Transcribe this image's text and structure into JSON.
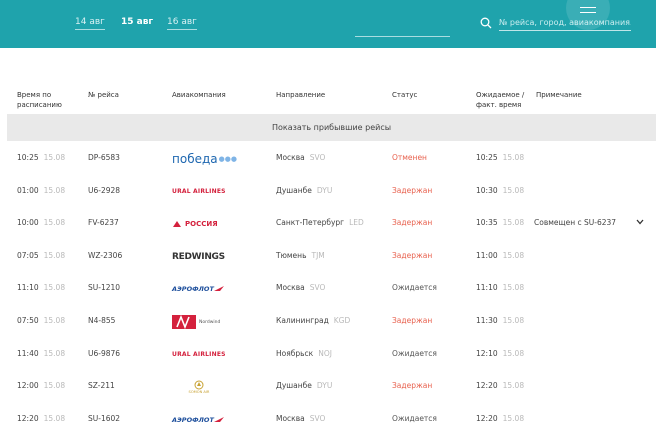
{
  "header": {
    "dates": [
      "14 авг",
      "15 авг",
      "16 авг"
    ],
    "active_date_index": 1,
    "search_placeholder": "№ рейса, город, авиакомпания..."
  },
  "table": {
    "columns": [
      "Время по\nрасписанию",
      "№ рейса",
      "Авиакомпания",
      "Направление",
      "Статус",
      "Ожидаемое /\nфакт. время",
      "Примечание"
    ],
    "show_arrived_label": "Показать прибывшие рейсы",
    "rows": [
      {
        "time": "10:25",
        "date": "15.08",
        "flight": "DP-6583",
        "airline": "pobeda",
        "city": "Москва",
        "code": "SVO",
        "status": "Отменен",
        "status_kind": "red",
        "exp_time": "10:25",
        "exp_date": "15.08",
        "note": ""
      },
      {
        "time": "01:00",
        "date": "15.08",
        "flight": "U6-2928",
        "airline": "ural",
        "city": "Душанбе",
        "code": "DYU",
        "status": "Задержан",
        "status_kind": "red",
        "exp_time": "10:30",
        "exp_date": "15.08",
        "note": ""
      },
      {
        "time": "10:00",
        "date": "15.08",
        "flight": "FV-6237",
        "airline": "rossiya",
        "city": "Санкт-Петербург",
        "code": "LED",
        "status": "Задержан",
        "status_kind": "red",
        "exp_time": "10:35",
        "exp_date": "15.08",
        "note": "Совмещен с SU-6237"
      },
      {
        "time": "07:05",
        "date": "15.08",
        "flight": "WZ-2306",
        "airline": "redwings",
        "city": "Тюмень",
        "code": "TJM",
        "status": "Задержан",
        "status_kind": "red",
        "exp_time": "11:00",
        "exp_date": "15.08",
        "note": ""
      },
      {
        "time": "11:10",
        "date": "15.08",
        "flight": "SU-1210",
        "airline": "aeroflot",
        "city": "Москва",
        "code": "SVO",
        "status": "Ожидается",
        "status_kind": "grey",
        "exp_time": "11:10",
        "exp_date": "15.08",
        "note": ""
      },
      {
        "time": "07:50",
        "date": "15.08",
        "flight": "N4-855",
        "airline": "nordwind",
        "city": "Калининград",
        "code": "KGD",
        "status": "Задержан",
        "status_kind": "red",
        "exp_time": "11:30",
        "exp_date": "15.08",
        "note": ""
      },
      {
        "time": "11:40",
        "date": "15.08",
        "flight": "U6-9876",
        "airline": "ural",
        "city": "Ноябрьск",
        "code": "NOJ",
        "status": "Ожидается",
        "status_kind": "grey",
        "exp_time": "12:10",
        "exp_date": "15.08",
        "note": ""
      },
      {
        "time": "12:00",
        "date": "15.08",
        "flight": "SZ-211",
        "airline": "somon",
        "city": "Душанбе",
        "code": "DYU",
        "status": "Задержан",
        "status_kind": "red",
        "exp_time": "12:20",
        "exp_date": "15.08",
        "note": ""
      },
      {
        "time": "12:20",
        "date": "15.08",
        "flight": "SU-1602",
        "airline": "aeroflot",
        "city": "Москва",
        "code": "SVO",
        "status": "Ожидается",
        "status_kind": "grey",
        "exp_time": "12:20",
        "exp_date": "15.08",
        "note": ""
      }
    ]
  },
  "logos": {
    "pobeda": "победа",
    "ural": "URAL AIRLINES",
    "rossiya": "РОССИЯ",
    "redwings": "REDWINGS",
    "aeroflot": "АЭРОФЛОТ",
    "nordwind": "Nordwind",
    "somon": "SOMON AIR"
  },
  "colors": {
    "topbar": "#1fa3ac",
    "status_red": "#e8624f",
    "row_band": "#e9e9e9"
  }
}
